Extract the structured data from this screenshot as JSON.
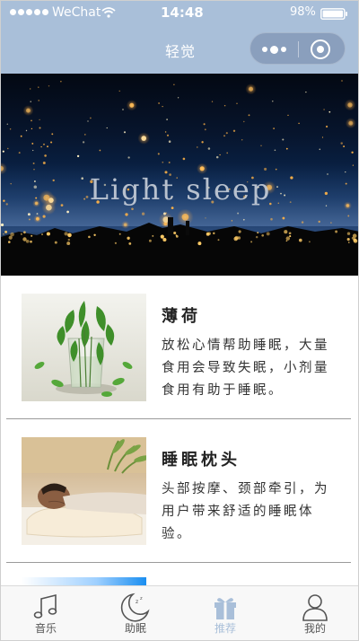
{
  "status_bar": {
    "carrier": "WeChat",
    "time": "14:48",
    "battery": "98%"
  },
  "nav": {
    "title": "轻觉"
  },
  "banner": {
    "text": "Light sleep"
  },
  "items": [
    {
      "title": "薄荷",
      "desc": "放松心情帮助睡眠，大量食用会导致失眠，小剂量食用有助于睡眠。"
    },
    {
      "title": "睡眠枕头",
      "desc": "头部按摩、颈部牵引，为用户带来舒适的睡眠体验。"
    }
  ],
  "tabs": [
    {
      "label": "音乐",
      "icon": "music-note-icon"
    },
    {
      "label": "助眠",
      "icon": "moon-icon"
    },
    {
      "label": "推荐",
      "icon": "gift-icon",
      "active": true
    },
    {
      "label": "我的",
      "icon": "user-icon"
    }
  ],
  "colors": {
    "primary": "#a9bfd9",
    "capsule": "#8a9fbd"
  }
}
